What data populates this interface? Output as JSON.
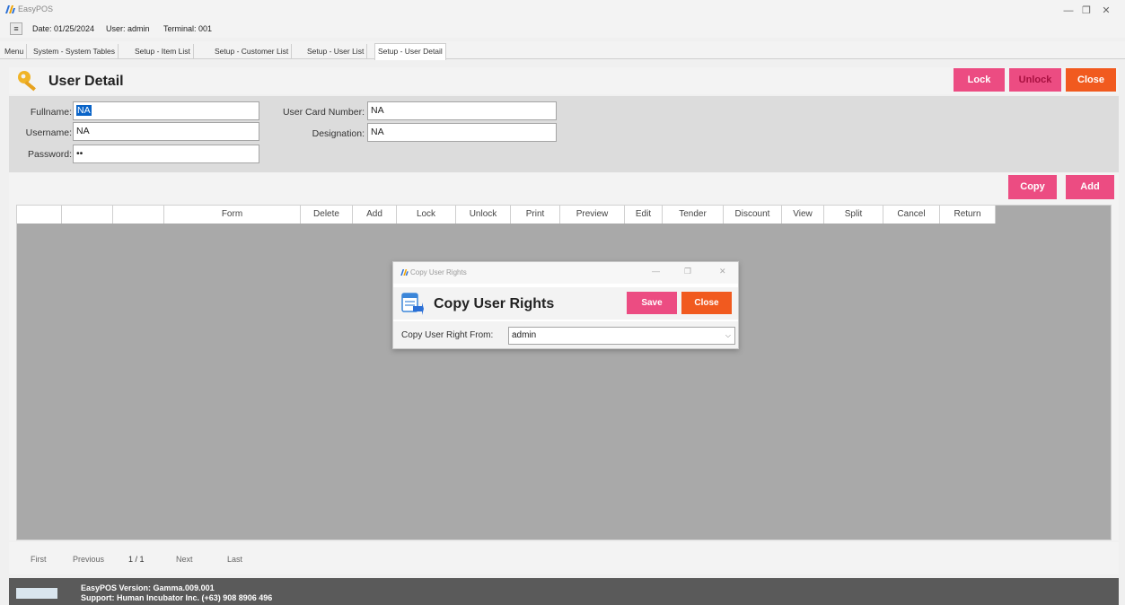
{
  "window": {
    "app_title": "EasyPOS",
    "minimize_glyph": "—",
    "restore_glyph": "❐",
    "close_glyph": "✕"
  },
  "infobar": {
    "menu_glyph": "≡",
    "date": "Date: 01/25/2024",
    "user": "User: admin",
    "terminal": "Terminal: 001"
  },
  "tabs": [
    {
      "label": "Menu"
    },
    {
      "label": "System - System Tables"
    },
    {
      "label": "Setup - Item List"
    },
    {
      "label": "Setup - Customer List"
    },
    {
      "label": "Setup - User List"
    },
    {
      "label": "Setup - User Detail"
    }
  ],
  "header": {
    "title": "User Detail",
    "lock_label": "Lock",
    "unlock_label": "Unlock",
    "close_label": "Close"
  },
  "form": {
    "fullname_label": "Fullname:",
    "fullname_value": "NA",
    "username_label": "Username:",
    "username_value": "NA",
    "password_label": "Password:",
    "password_value": "••",
    "card_label": "User Card Number:",
    "card_value": "NA",
    "designation_label": "Designation:",
    "designation_value": "NA"
  },
  "grid": {
    "copy_label": "Copy",
    "add_label": "Add",
    "columns": [
      "",
      "",
      "",
      "Form",
      "Delete",
      "Add",
      "Lock",
      "Unlock",
      "Print",
      "Preview",
      "Edit",
      "Tender",
      "Discount",
      "View",
      "Split",
      "Cancel",
      "Return"
    ]
  },
  "pager": {
    "first": "First",
    "previous": "Previous",
    "page": "1 / 1",
    "next": "Next",
    "last": "Last"
  },
  "footer": {
    "version": "EasyPOS Version: Gamma.009.001",
    "support": "Support: Human Incubator Inc. (+63) 908 8906 496"
  },
  "modal": {
    "window_title": "Copy User Rights",
    "heading": "Copy User Rights",
    "save_label": "Save",
    "close_label": "Close",
    "field_label": "Copy User Right From:",
    "field_value": "admin"
  },
  "colors": {
    "pink": "#ec4c82",
    "dark_pink": "#c8175e",
    "orange": "#f15a1f",
    "footer": "#5a5a5a",
    "grid_bg": "#a9a9a9"
  }
}
